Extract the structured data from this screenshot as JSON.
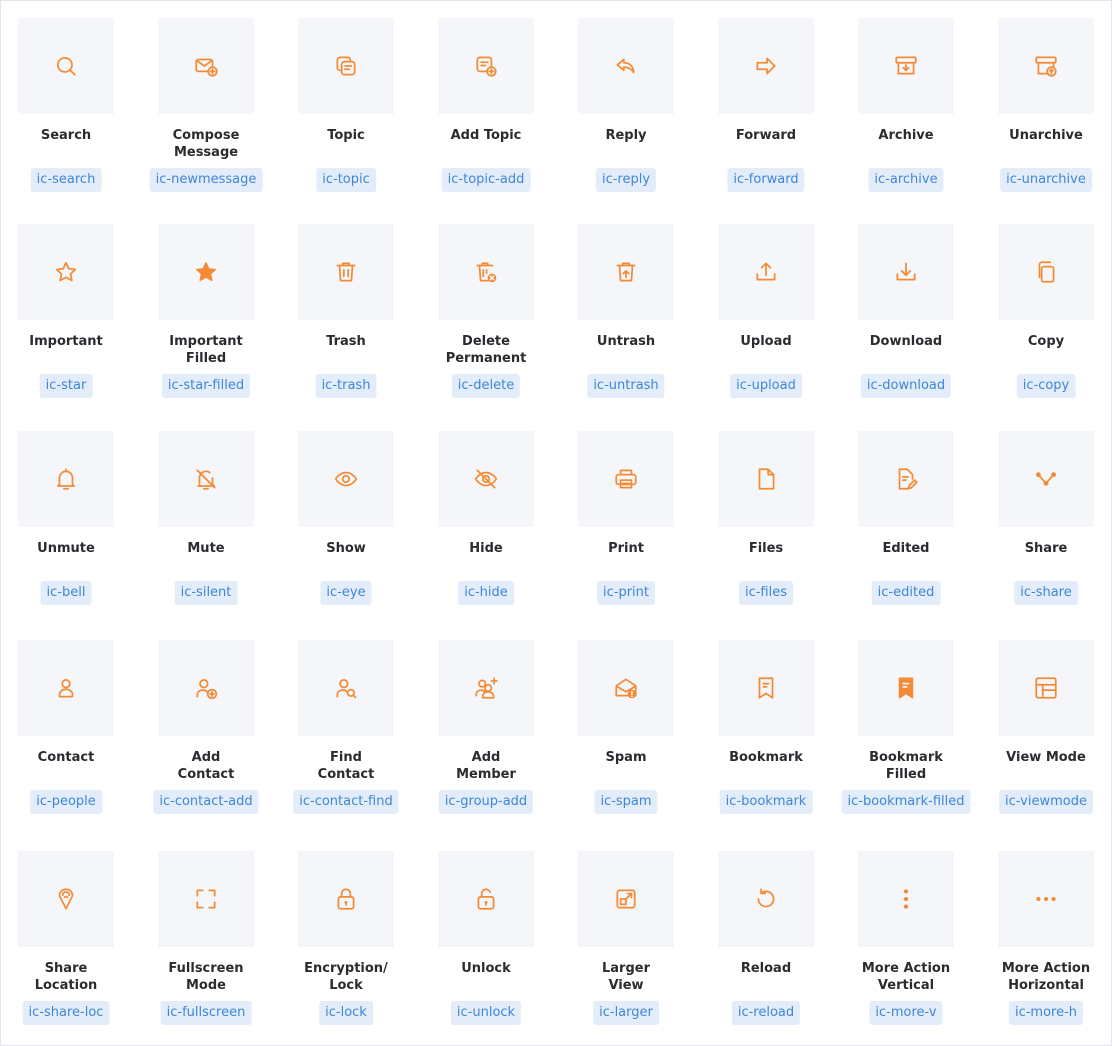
{
  "accent": "#f48b34",
  "tile_bg": "#f4f6fa",
  "code_bg": "#e3edf9",
  "code_fg": "#3f86d6",
  "rows": [
    [
      {
        "label": "Search",
        "code": "ic-search",
        "icon": "search-icon"
      },
      {
        "label": "Compose\nMessage",
        "code": "ic-newmessage",
        "icon": "compose-icon"
      },
      {
        "label": "Topic",
        "code": "ic-topic",
        "icon": "topic-icon"
      },
      {
        "label": "Add Topic",
        "code": "ic-topic-add",
        "icon": "topic-add-icon"
      },
      {
        "label": "Reply",
        "code": "ic-reply",
        "icon": "reply-icon"
      },
      {
        "label": "Forward",
        "code": "ic-forward",
        "icon": "forward-icon"
      },
      {
        "label": "Archive",
        "code": "ic-archive",
        "icon": "archive-icon"
      },
      {
        "label": "Unarchive",
        "code": "ic-unarchive",
        "icon": "unarchive-icon"
      }
    ],
    [
      {
        "label": "Important",
        "code": "ic-star",
        "icon": "star-icon"
      },
      {
        "label": "Important\nFilled",
        "code": "ic-star-filled",
        "icon": "star-filled-icon"
      },
      {
        "label": "Trash",
        "code": "ic-trash",
        "icon": "trash-icon"
      },
      {
        "label": "Delete\nPermanent",
        "code": "ic-delete",
        "icon": "delete-icon"
      },
      {
        "label": "Untrash",
        "code": "ic-untrash",
        "icon": "untrash-icon"
      },
      {
        "label": "Upload",
        "code": "ic-upload",
        "icon": "upload-icon"
      },
      {
        "label": "Download",
        "code": "ic-download",
        "icon": "download-icon"
      },
      {
        "label": "Copy",
        "code": "ic-copy",
        "icon": "copy-icon"
      }
    ],
    [
      {
        "label": "Unmute",
        "code": "ic-bell",
        "icon": "bell-icon"
      },
      {
        "label": "Mute",
        "code": "ic-silent",
        "icon": "bell-off-icon"
      },
      {
        "label": "Show",
        "code": "ic-eye",
        "icon": "eye-icon"
      },
      {
        "label": "Hide",
        "code": "ic-hide",
        "icon": "eye-off-icon"
      },
      {
        "label": "Print",
        "code": "ic-print",
        "icon": "print-icon"
      },
      {
        "label": "Files",
        "code": "ic-files",
        "icon": "file-icon"
      },
      {
        "label": "Edited",
        "code": "ic-edited",
        "icon": "edited-icon"
      },
      {
        "label": "Share",
        "code": "ic-share",
        "icon": "share-icon"
      }
    ],
    [
      {
        "label": "Contact",
        "code": "ic-people",
        "icon": "person-icon"
      },
      {
        "label": "Add\nContact",
        "code": "ic-contact-add",
        "icon": "person-add-icon"
      },
      {
        "label": "Find\nContact",
        "code": "ic-contact-find",
        "icon": "person-find-icon"
      },
      {
        "label": "Add\nMember",
        "code": "ic-group-add",
        "icon": "group-add-icon"
      },
      {
        "label": "Spam",
        "code": "ic-spam",
        "icon": "spam-icon"
      },
      {
        "label": "Bookmark",
        "code": "ic-bookmark",
        "icon": "bookmark-icon"
      },
      {
        "label": "Bookmark\nFilled",
        "code": "ic-bookmark-filled",
        "icon": "bookmark-filled-icon"
      },
      {
        "label": "View Mode",
        "code": "ic-viewmode",
        "icon": "viewmode-icon"
      }
    ],
    [
      {
        "label": "Share\nLocation",
        "code": "ic-share-loc",
        "icon": "location-icon"
      },
      {
        "label": "Fullscreen\nMode",
        "code": "ic-fullscreen",
        "icon": "fullscreen-icon"
      },
      {
        "label": "Encryption/\nLock",
        "code": "ic-lock",
        "icon": "lock-icon"
      },
      {
        "label": "Unlock",
        "code": "ic-unlock",
        "icon": "unlock-icon"
      },
      {
        "label": "Larger\nView",
        "code": "ic-larger",
        "icon": "larger-icon"
      },
      {
        "label": "Reload",
        "code": "ic-reload",
        "icon": "reload-icon"
      },
      {
        "label": "More Action\nVertical",
        "code": "ic-more-v",
        "icon": "more-vertical-icon"
      },
      {
        "label": "More Action\nHorizontal",
        "code": "ic-more-h",
        "icon": "more-horizontal-icon"
      }
    ]
  ]
}
